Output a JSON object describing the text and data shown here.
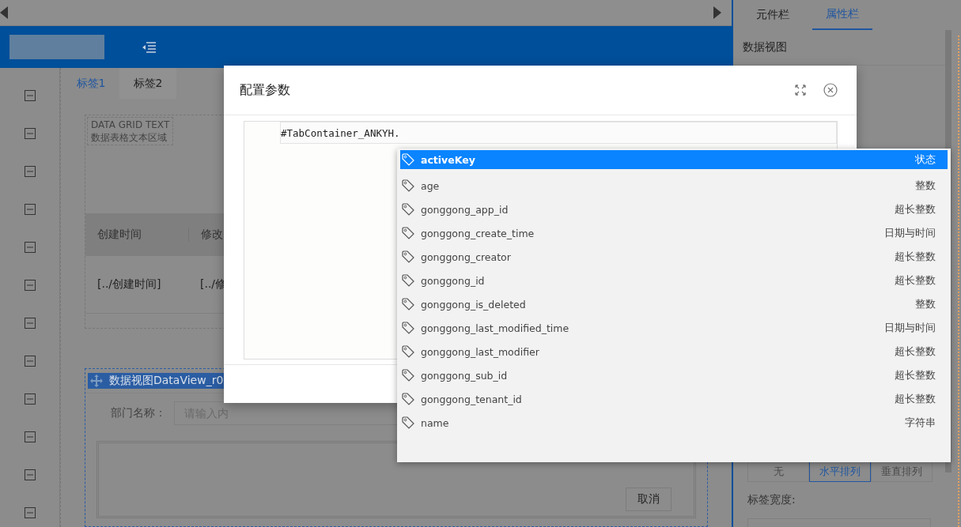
{
  "right_panel": {
    "tabs": [
      {
        "label": "元件栏",
        "selected": false
      },
      {
        "label": "属性栏",
        "selected": true
      }
    ],
    "section_title": "数据视图",
    "arrange_options": [
      {
        "label": "无",
        "selected": false
      },
      {
        "label": "水平排列",
        "selected": true
      },
      {
        "label": "垂直排列",
        "selected": false
      }
    ],
    "width_label": "标签宽度:"
  },
  "canvas": {
    "tabs": [
      {
        "label": "标签1",
        "selected": true
      },
      {
        "label": "标签2",
        "selected": false
      }
    ],
    "grid_text_title": "DATA GRID TEXT",
    "grid_text_subtitle": "数据表格文本区域",
    "table": {
      "columns": [
        "创建时间",
        "修改"
      ],
      "row": [
        "[../创建时间]",
        "[../修"
      ]
    },
    "dataview": {
      "title": "数据视图DataView_r0",
      "field_label": "部门名称：",
      "field_placeholder": "请输入内",
      "cancel": "取消"
    }
  },
  "dialog": {
    "title": "配置参数",
    "code": "#TabContainer_ANKYH."
  },
  "suggestions": [
    {
      "name": "activeKey",
      "type": "状态",
      "selected": true
    },
    {
      "name": "age",
      "type": "整数",
      "selected": false
    },
    {
      "name": "gonggong_app_id",
      "type": "超长整数",
      "selected": false
    },
    {
      "name": "gonggong_create_time",
      "type": "日期与时间",
      "selected": false
    },
    {
      "name": "gonggong_creator",
      "type": "超长整数",
      "selected": false
    },
    {
      "name": "gonggong_id",
      "type": "超长整数",
      "selected": false
    },
    {
      "name": "gonggong_is_deleted",
      "type": "整数",
      "selected": false
    },
    {
      "name": "gonggong_last_modified_time",
      "type": "日期与时间",
      "selected": false
    },
    {
      "name": "gonggong_last_modifier",
      "type": "超长整数",
      "selected": false
    },
    {
      "name": "gonggong_sub_id",
      "type": "超长整数",
      "selected": false
    },
    {
      "name": "gonggong_tenant_id",
      "type": "超长整数",
      "selected": false
    },
    {
      "name": "name",
      "type": "字符串",
      "selected": false
    }
  ]
}
